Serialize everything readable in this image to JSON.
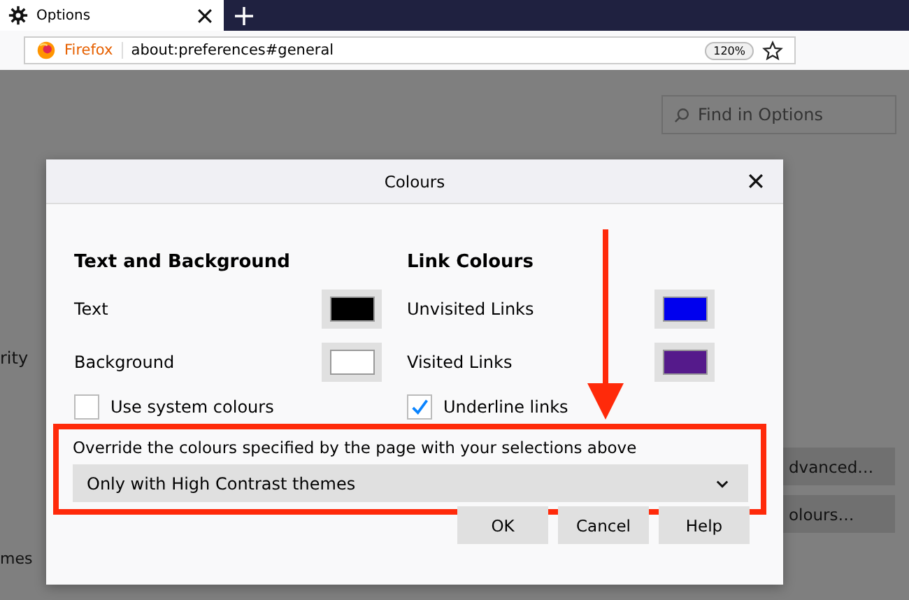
{
  "tabs": [
    {
      "label": "Options",
      "selected": true
    }
  ],
  "address_bar": {
    "identity": "Firefox",
    "url": "about:preferences#general",
    "zoom": "120%"
  },
  "page": {
    "search": {
      "placeholder": "Find in Options"
    },
    "partial_texts": [
      "rity",
      "mes"
    ],
    "partial_buttons": [
      "dvanced…",
      "olours…"
    ]
  },
  "dialog": {
    "title": "Colours",
    "sections": [
      {
        "heading": "Text and Background",
        "rows": [
          {
            "label": "Text",
            "color": "#000000"
          },
          {
            "label": "Background",
            "color": "#ffffff"
          }
        ],
        "checkbox": {
          "label": "Use system colours",
          "checked": false
        }
      },
      {
        "heading": "Link Colours",
        "rows": [
          {
            "label": "Unvisited Links",
            "color": "#0000ee"
          },
          {
            "label": "Visited Links",
            "color": "#551a8b"
          }
        ],
        "checkbox": {
          "label": "Underline links",
          "checked": true
        }
      }
    ],
    "override": {
      "label": "Override the colours specified by the page with your selections above",
      "value": "Only with High Contrast themes",
      "highlighted": true
    },
    "buttons": [
      "OK",
      "Cancel",
      "Help"
    ]
  }
}
